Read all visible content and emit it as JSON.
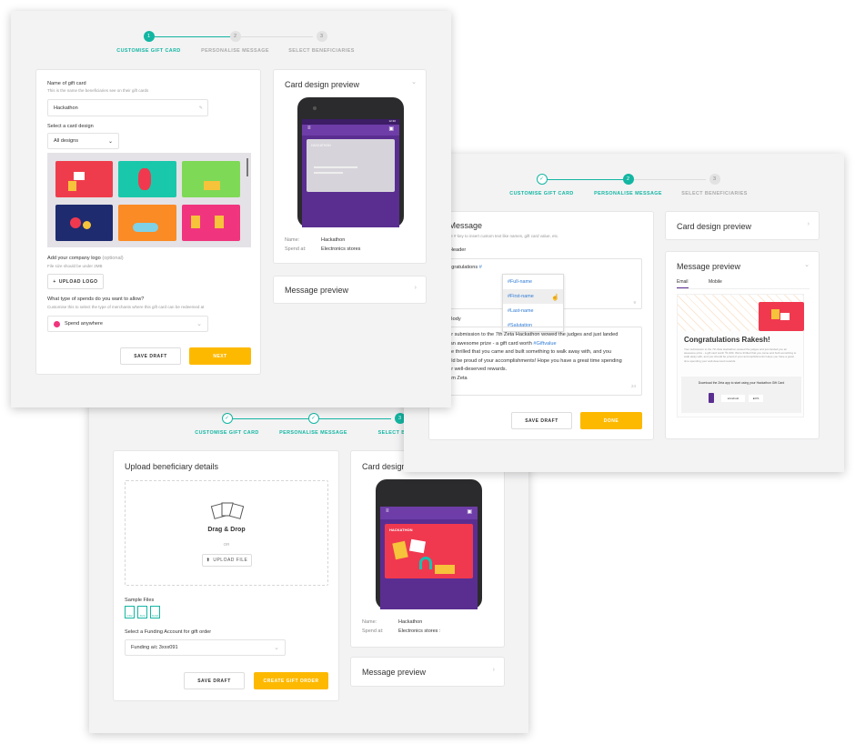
{
  "colors": {
    "accent": "#13b6a2",
    "primary_button": "#fdb900",
    "screen": "#5a2e91",
    "link": "#2e7bd6"
  },
  "steps": {
    "customise": "CUSTOMISE GIFT CARD",
    "personalise": "PERSONALISE MESSAGE",
    "select": "SELECT BENEFICIARIES",
    "select_cut": "SELECT BENEFI",
    "n1": "1",
    "n2": "2",
    "n3": "3",
    "check": "✓"
  },
  "card1": {
    "name_label": "Name of gift card",
    "name_help": "This is the name the beneficiaries see on their gift cards",
    "name_value": "Hackathon",
    "design_label": "Select a card design",
    "design_filter": "All designs",
    "logo_label": "Add your company logo",
    "logo_optional": "(optional)",
    "logo_help": "File size should be under 2MB",
    "upload_logo": "UPLOAD LOGO",
    "spends_label": "What type of spends do you want to allow?",
    "spends_help": "Customise this to select the type of merchants where this gift card can be redeemed at",
    "spends_value": "Spend anywhere",
    "save_draft": "SAVE DRAFT",
    "next": "NEXT"
  },
  "preview": {
    "title": "Card design preview",
    "card_label": "HACKATHON",
    "name_key": "Name:",
    "name_val": "Hackathon",
    "spend_key": "Spend at:",
    "spend_val": "Electronics stores",
    "message_preview": "Message preview",
    "status_time": "12:30"
  },
  "card2": {
    "title": "ur Message",
    "help": "ep, use # key to insert custom text like names, gift card value, etc.",
    "header_label": "age Header",
    "header_text": "ongratulations",
    "hash": "#",
    "menu": [
      "#Full-name",
      "#First-name",
      "#Last-name",
      "#Salutation"
    ],
    "body_label": "age Body",
    "body_lines": [
      "our submission to the 7th Zeta Hackathon wowed the judges and just landed",
      "u an awesome prize - a gift card worth",
      "e're thrilled that you came and built something to walk away with, and you",
      "ould be proud of your accomplishments! Hope you have a great time spending",
      "our well-deserved rewards.",
      "eam Zeta"
    ],
    "giftvalue": "#Giftvalue",
    "counter": "24",
    "header_counter": "9",
    "save_draft": "SAVE DRAFT",
    "done": "DONE",
    "msg_preview_title": "Message preview",
    "tab_email": "Email",
    "tab_mobile": "Mobile",
    "congrats": "Congratulations Rakesh!",
    "email_body": "Your submission to the 7th Zeta Hackathon wowed the judges and just landed you an awesome prize - a gift card worth ₹1,000. We're thrilled that you came and built something to walk away with, and you should be proud of your accomplishments! Hope you have a great time spending your well-deserved rewards.",
    "download_text": "Download the Zeta app to start using your Hackathon Gift Card",
    "android": "Android",
    "ios": "iOS"
  },
  "card3": {
    "title": "Upload beneficiary details",
    "drag": "Drag & Drop",
    "or": "OR",
    "upload_file": "UPLOAD FILE",
    "sample_files": "Sample Files",
    "file_types": [
      "CSV",
      "XLS",
      "XLSX"
    ],
    "funding_label": "Select a Funding Account  for gift order",
    "funding_value": "Funding a/c 3xxx091",
    "save_draft": "SAVE DRAFT",
    "create": "CREATE GIFT ORDER",
    "card_design_cut": "Card design",
    "message_preview": "Message preview",
    "spend_val": "Electronics stores :"
  }
}
